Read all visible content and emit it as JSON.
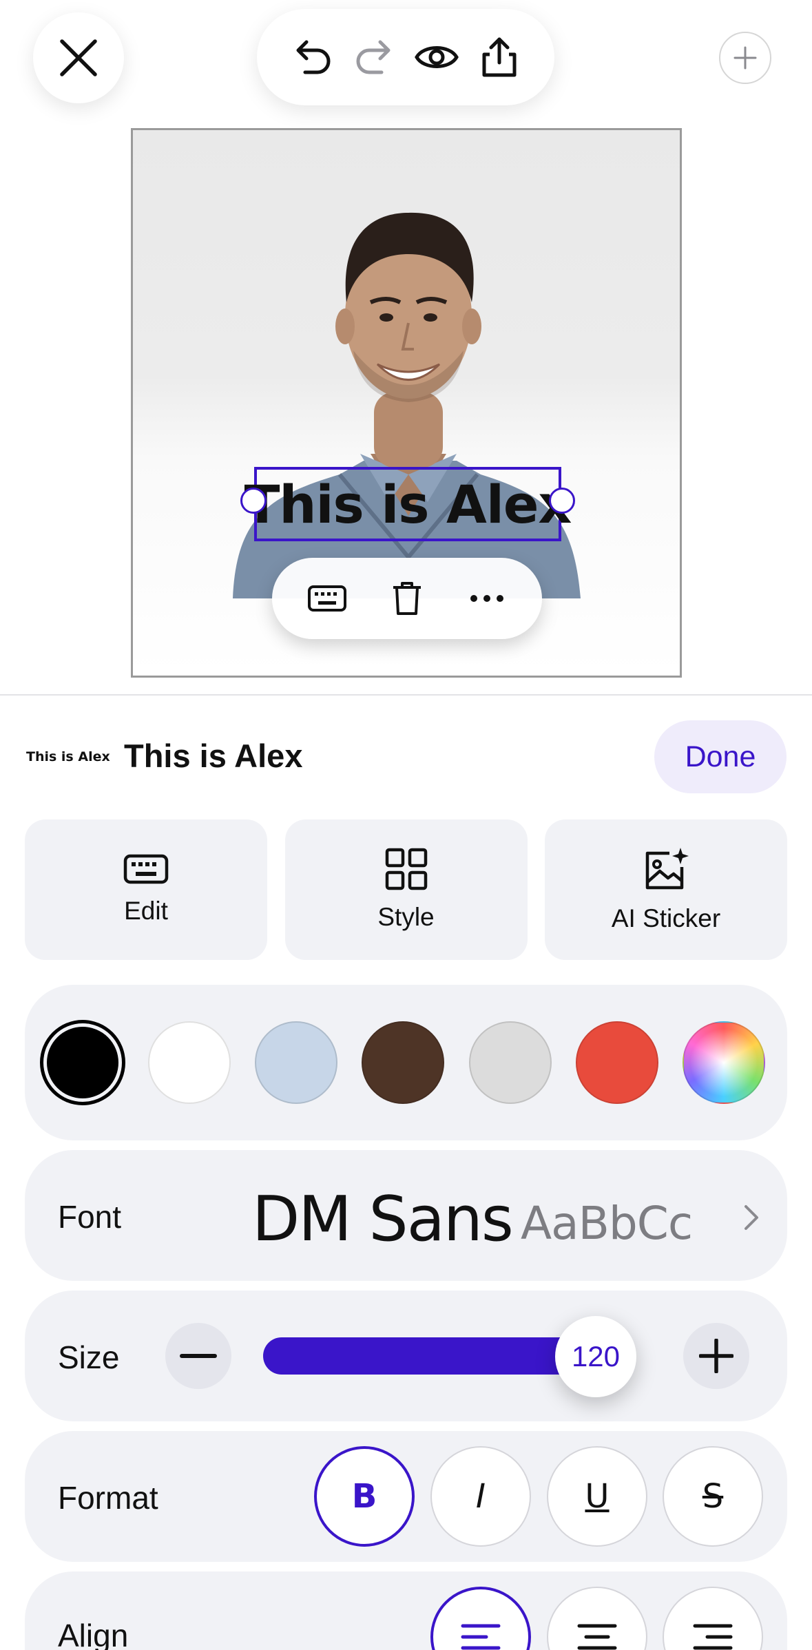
{
  "topbar": {
    "close_icon": "close-icon",
    "actions": [
      "undo-icon",
      "redo-icon",
      "preview-eye-icon",
      "share-icon"
    ],
    "add_icon": "plus-icon"
  },
  "canvas": {
    "text": "This is Alex",
    "context_actions": [
      "keyboard-icon",
      "trash-icon",
      "more-icon"
    ]
  },
  "sheet": {
    "mini_preview": "This is Alex",
    "title": "This is Alex",
    "done_label": "Done",
    "tiles": [
      {
        "label": "Edit",
        "icon": "keyboard-icon"
      },
      {
        "label": "Style",
        "icon": "grid-icon"
      },
      {
        "label": "AI Sticker",
        "icon": "ai-image-icon"
      }
    ],
    "colors": [
      "#000000",
      "#ffffff",
      "#c7d6e8",
      "#4e3426",
      "#dcdcdc",
      "#e84b3c",
      "rainbow"
    ],
    "selected_color": "#000000",
    "font": {
      "label": "Font",
      "name": "DM Sans",
      "sample": "AaBbCc"
    },
    "size": {
      "label": "Size",
      "value": "120",
      "level_percent": 88
    },
    "format": {
      "label": "Format",
      "bold": "B",
      "italic": "I",
      "underline": "U",
      "strike": "S",
      "active": "bold"
    },
    "align": {
      "label": "Align",
      "active": "left"
    }
  },
  "colors": {
    "accent": "#3a15c9",
    "card_bg": "#f1f2f6"
  }
}
